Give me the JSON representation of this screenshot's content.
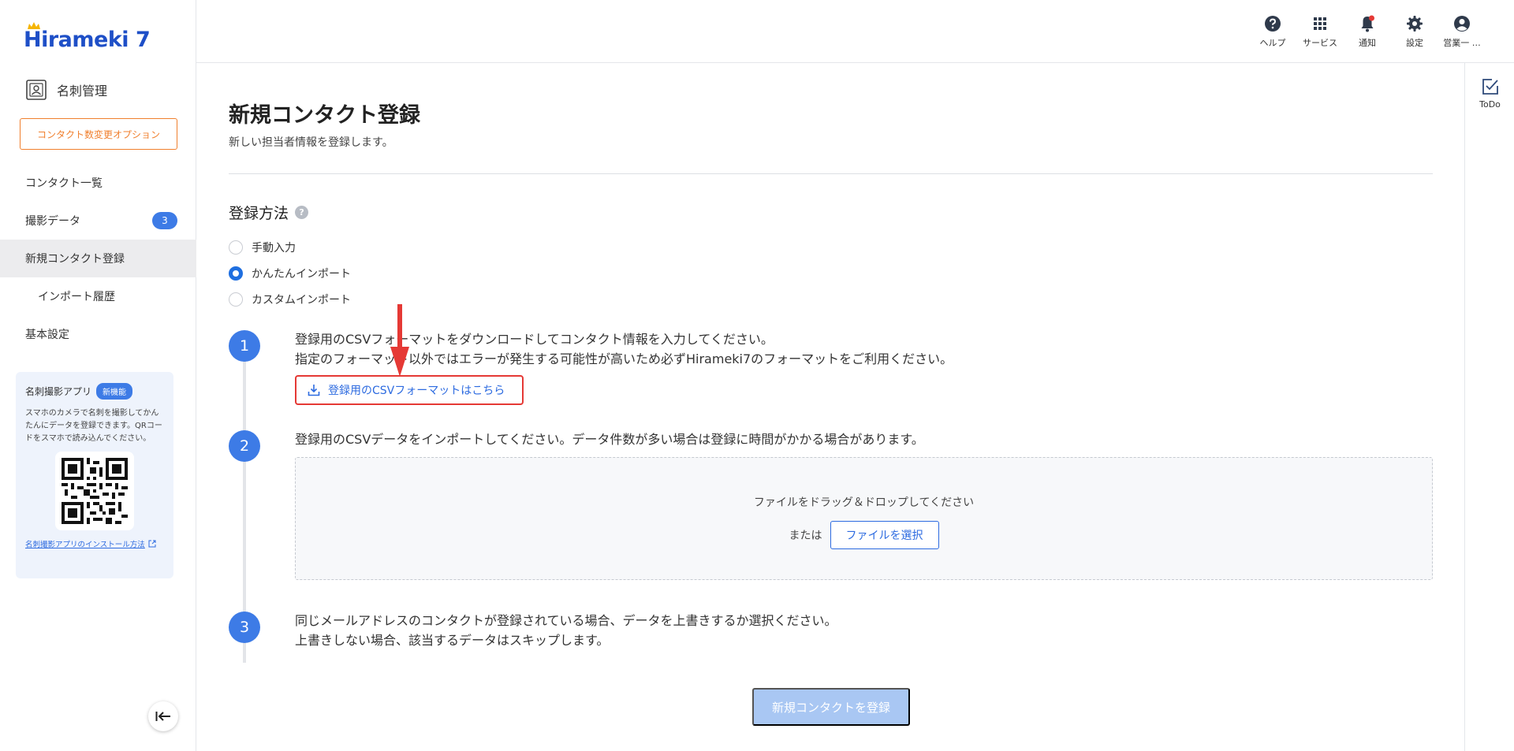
{
  "brand": {
    "logo_text": "Hirameki 7"
  },
  "sidebar": {
    "module_label": "名刺管理",
    "option_button": "コンタクト数変更オプション",
    "items": [
      {
        "label": "コンタクト一覧"
      },
      {
        "label": "撮影データ",
        "badge": "3"
      },
      {
        "label": "新規コンタクト登録"
      },
      {
        "label": "インポート履歴"
      },
      {
        "label": "基本設定"
      }
    ],
    "app_card": {
      "title": "名刺撮影アプリ",
      "badge": "新機能",
      "description": "スマホのカメラで名刺を撮影してかんたんにデータを登録できます。QRコードをスマホで読み込んでください。",
      "link": "名刺撮影アプリのインストール方法"
    }
  },
  "header": {
    "actions": [
      {
        "label": "ヘルプ",
        "icon": "help-icon"
      },
      {
        "label": "サービス",
        "icon": "grid-icon"
      },
      {
        "label": "通知",
        "icon": "bell-icon"
      },
      {
        "label": "設定",
        "icon": "gear-icon"
      },
      {
        "label": "営業一 …",
        "icon": "user-icon"
      }
    ]
  },
  "right_rail": {
    "todo_label": "ToDo"
  },
  "main": {
    "title": "新規コンタクト登録",
    "subtitle": "新しい担当者情報を登録します。",
    "method_title": "登録方法",
    "help_mark": "?",
    "methods": [
      {
        "label": "手動入力",
        "checked": false
      },
      {
        "label": "かんたんインポート",
        "checked": true
      },
      {
        "label": "カスタムインポート",
        "checked": false
      }
    ],
    "steps": [
      {
        "num": "1",
        "line1": "登録用のCSVフォーマットをダウンロードしてコンタクト情報を入力してください。",
        "line2": "指定のフォーマット以外ではエラーが発生する可能性が高いため必ずHirameki7のフォーマットをご利用ください。",
        "link": "登録用のCSVフォーマットはこちら"
      },
      {
        "num": "2",
        "line1": "登録用のCSVデータをインポートしてください。データ件数が多い場合は登録に時間がかかる場合があります。"
      },
      {
        "num": "3",
        "line1": "同じメールアドレスのコンタクトが登録されている場合、データを上書きするか選択ください。",
        "line2": "上書きしない場合、該当するデータはスキップします。"
      }
    ],
    "dropzone": {
      "text": "ファイルをドラッグ＆ドロップしてください",
      "or": "または",
      "button": "ファイルを選択"
    },
    "submit": "新規コンタクトを登録"
  },
  "colors": {
    "primary": "#3d7be6",
    "brand": "#1e4fc7",
    "orange": "#f07f2d",
    "highlight": "#e53935",
    "submit_disabled": "#a9c7f3"
  }
}
